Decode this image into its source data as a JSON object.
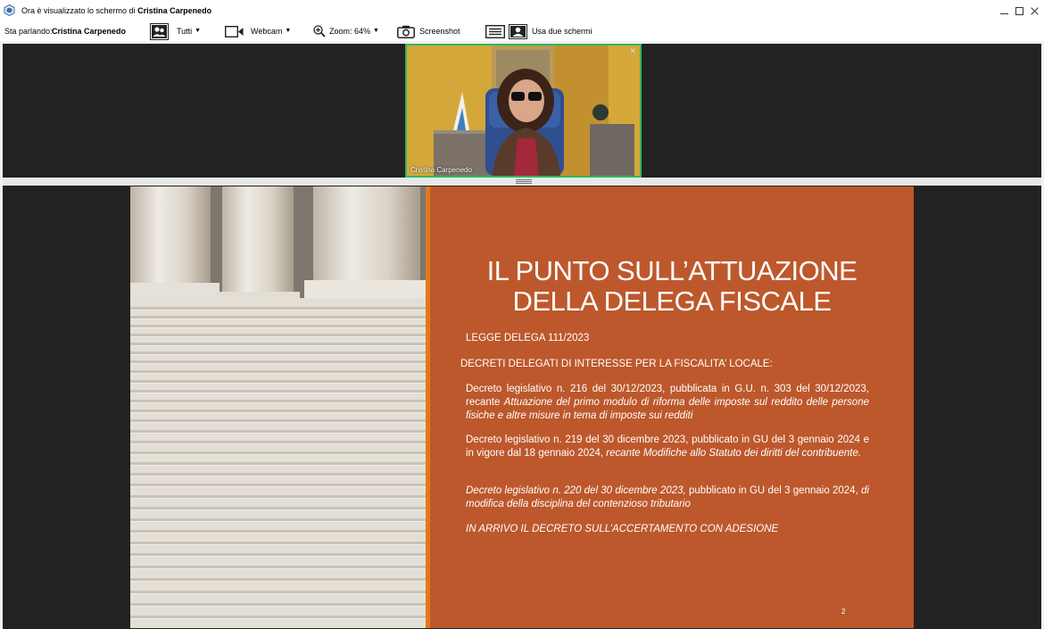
{
  "window": {
    "title_prefix": "Ora è visualizzato lo schermo di",
    "title_name": "Cristina Carpenedo"
  },
  "toolbar": {
    "speaking_label": "Sta parlando:",
    "speaking_name": "Cristina Carpenedo",
    "tutti_label": "Tutti",
    "webcam_label": "Webcam",
    "zoom_label": "Zoom: 64%",
    "screenshot_label": "Screenshot",
    "dual_screen_label": "Usa due schermi"
  },
  "webcam": {
    "participant_name": "Cristina Carpenedo"
  },
  "slide": {
    "title_line1": "IL PUNTO SULL’ATTUAZIONE",
    "title_line2": "DELLA DELEGA FISCALE",
    "law": "LEGGE DELEGA 111/2023",
    "heading": "DECRETI DELEGATI DI INTERESSE PER LA FISCALITA’ LOCALE:",
    "decree1_plain": "Decreto legislativo n. 216 del 30/12/2023, pubblicata in G.U. n. 303 del 30/12/2023, recante ",
    "decree1_italic": "Attuazione del primo modulo di riforma delle imposte sul reddito delle persone fisiche e altre misure in tema di imposte sui redditi",
    "decree2_plain": "Decreto legislativo n. 219 del 30 dicembre 2023, pubblicato in GU del 3 gennaio 2024 e in vigore dal 18 gennaio 2024, ",
    "decree2_italic": "recante Modifiche allo Statuto dei diritti del contribuente.",
    "decree3_italic": "Decreto legislativo n. 220 del 30 dicembre 2023,",
    "decree3_plain": " pubblicato in GU del 3 gennaio 2024, ",
    "decree3_italic2": "di modifica della disciplina del contenzioso tributario",
    "upcoming": "IN ARRIVO IL DECRETO SULL’ACCERTAMENTO CON ADESIONE",
    "page_number": "2"
  },
  "colors": {
    "slide_panel": "#bd582c",
    "slide_accent": "#e07a1c",
    "active_speaker_border": "#2eb85c",
    "dark_background": "#222222"
  }
}
